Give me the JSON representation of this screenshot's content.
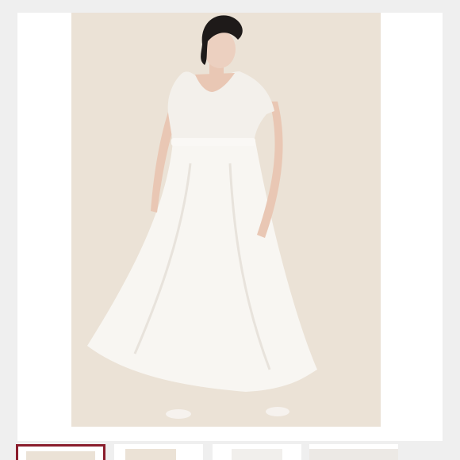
{
  "product": {
    "image_alt": "",
    "colors": {
      "backdrop": "#ebe2d6",
      "dress": "#f8f6f2",
      "hair": "#1e1a19",
      "skin": "#e9c7b4",
      "active_thumb_border": "#8a1d2c"
    }
  },
  "gallery": {
    "thumbnails": [
      {
        "name": "thumbnail-1",
        "active": true
      },
      {
        "name": "thumbnail-2",
        "active": false
      },
      {
        "name": "thumbnail-3",
        "active": false
      },
      {
        "name": "thumbnail-4",
        "active": false
      }
    ]
  }
}
